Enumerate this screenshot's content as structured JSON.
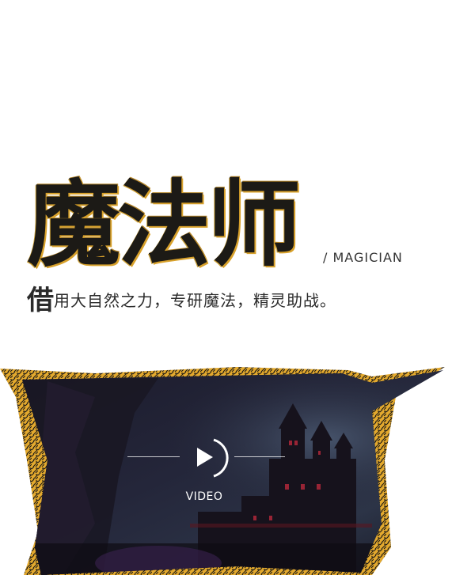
{
  "hero": {
    "title": "魔法师",
    "subtitle_en": "/ MAGICIAN"
  },
  "slogan": {
    "lead_char": "借",
    "rest": "用大自然之力，专研魔法，精灵助战。"
  },
  "video": {
    "label": "VIDEO",
    "icon": "play-icon"
  },
  "colors": {
    "accent_gold": "#d8a12b",
    "title_dark": "#1c1a16",
    "text": "#2b2b2b"
  }
}
